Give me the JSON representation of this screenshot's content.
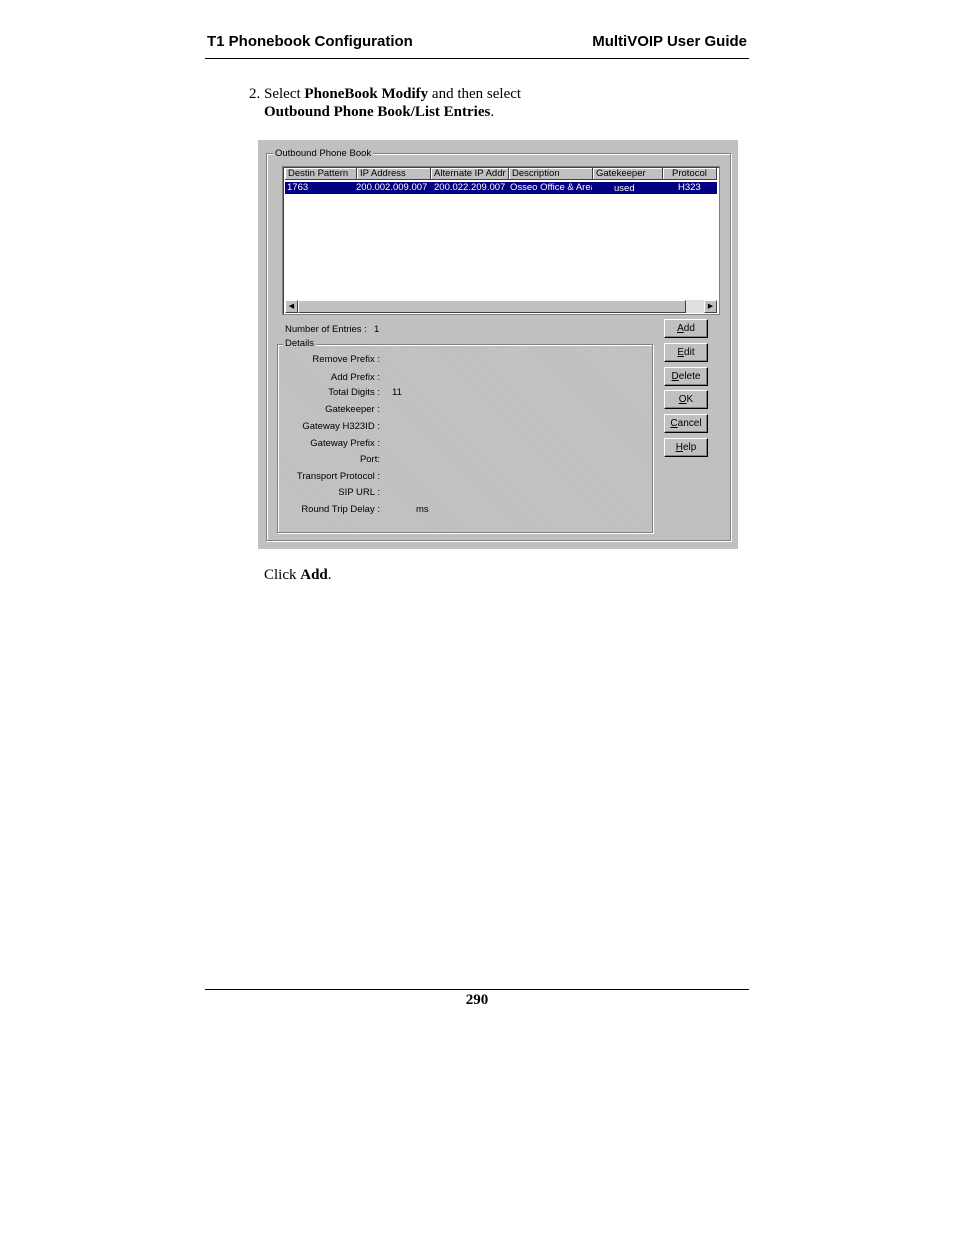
{
  "header": {
    "left": "T1 Phonebook Configuration",
    "right": "MultiVOIP User Guide"
  },
  "instruction": {
    "prefix": "2. Select ",
    "menu": "PhoneBook Modify",
    "middle": " and then select",
    "item": "Outbound Phone Book/List Entries",
    "suffix": "."
  },
  "dialog": {
    "group_title": "Outbound Phone Book",
    "columns": [
      "Destin Pattern",
      "IP Address",
      "Alternate IP Addr",
      "Description",
      "Gatekeeper",
      "Protocol"
    ],
    "rows": [
      {
        "destin_pattern": "1763",
        "ip_address": "200.002.009.007",
        "alternate_ip": "200.022.209.007",
        "description": "Osseo Office & Area",
        "gatekeeper": "used",
        "protocol": "H323"
      }
    ],
    "number_of_entries_label": "Number of Entries :",
    "number_of_entries": "1",
    "details_title": "Details",
    "details": [
      {
        "label": "Remove Prefix :",
        "value": ""
      },
      {
        "label": "Add Prefix :",
        "value": ""
      },
      {
        "label": "Total Digits :",
        "value": "11"
      },
      {
        "label": "Gatekeeper :",
        "value": ""
      },
      {
        "label": "Gateway H323ID :",
        "value": ""
      },
      {
        "label": "Gateway Prefix :",
        "value": ""
      },
      {
        "label": "Port:",
        "value": ""
      },
      {
        "label": "Transport Protocol :",
        "value": ""
      },
      {
        "label": "SIP URL :",
        "value": ""
      },
      {
        "label": "Round Trip Delay :",
        "value": "ms"
      }
    ],
    "buttons": {
      "add": {
        "first": "A",
        "rest": "dd"
      },
      "edit": {
        "first": "E",
        "rest": "dit"
      },
      "delete": {
        "first": "D",
        "rest": "elete"
      },
      "ok": {
        "first": "O",
        "rest": "K"
      },
      "cancel": {
        "first": "C",
        "rest": "ancel"
      },
      "help": {
        "first": "H",
        "rest": "elp"
      }
    }
  },
  "after": {
    "prefix": "Click ",
    "bold": "Add",
    "suffix": "."
  },
  "page_number": "290"
}
